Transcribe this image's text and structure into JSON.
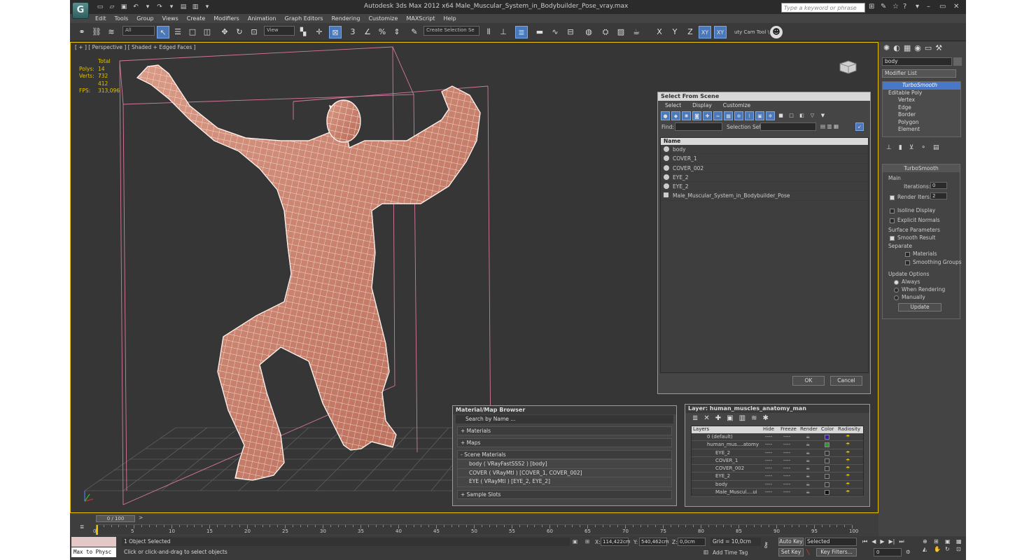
{
  "app": {
    "logo": "G",
    "title": "Autodesk 3ds Max  2012 x64     Male_Muscular_System_in_Bodybuilder_Pose_vray.max",
    "search_placeholder": "Type a keyword or phrase"
  },
  "menu": [
    "Edit",
    "Tools",
    "Group",
    "Views",
    "Create",
    "Modifiers",
    "Animation",
    "Graph Editors",
    "Rendering",
    "Customize",
    "MAXScript",
    "Help"
  ],
  "toolbar": {
    "filter": "All",
    "view": "View",
    "selection_set": "Create Selection Se",
    "axis_x": "X",
    "axis_y": "Y",
    "axis_z": "Z",
    "axis_xy": "XY",
    "axis_xy2": "XY",
    "cam_tool": "uty Cam Tool \\"
  },
  "viewport": {
    "label": "[ + ] [ Perspective ] [ Shaded + Edged Faces ]",
    "total_label": "Total",
    "polys_label": "Polys:",
    "polys_value": "14 732",
    "verts_label": "Verts:",
    "verts_value": "7 412",
    "fps_label": "FPS:",
    "fps_value": "313,096"
  },
  "command_panel": {
    "object_name": "body",
    "modifier_list": "Modifier List",
    "stack": [
      "TurboSmooth",
      "Editable Poly",
      "Vertex",
      "Edge",
      "Border",
      "Polygon",
      "Element"
    ],
    "rollout_title": "TurboSmooth",
    "main": "Main",
    "iterations_label": "Iterations:",
    "iterations_value": "0",
    "render_iters_label": "Render Iters:",
    "render_iters_value": "2",
    "isoline": "Isoline Display",
    "explicit": "Explicit Normals",
    "surface_params": "Surface Parameters",
    "smooth_result": "Smooth Result",
    "separate": "Separate",
    "materials": "Materials",
    "smoothing_groups": "Smoothing Groups",
    "update_options": "Update Options",
    "always": "Always",
    "when_rendering": "When Rendering",
    "manually": "Manually",
    "update_btn": "Update"
  },
  "select_from_scene": {
    "title": "Select From Scene",
    "menus": [
      "Select",
      "Display",
      "Customize"
    ],
    "find_label": "Find:",
    "selection_set_label": "Selection Set:",
    "name_header": "Name",
    "items": [
      "body",
      "COVER_1",
      "COVER_002",
      "EYE_2",
      "EYE_2",
      "Male_Muscular_System_in_Bodybuilder_Pose"
    ],
    "ok": "OK",
    "cancel": "Cancel"
  },
  "material_browser": {
    "title": "Material/Map Browser",
    "search_placeholder": "Search by Name ...",
    "materials": "+ Materials",
    "maps": "+ Maps",
    "scene_materials": "- Scene Materials",
    "scene_items": [
      "body  ( VRayFastSSS2 ) [body]",
      "COVER  ( VRayMtl ) [COVER_1, COVER_002]",
      "EYE  ( VRayMtl ) [EYE_2, EYE_2]"
    ],
    "sample_slots": "+ Sample Slots"
  },
  "layer_dialog": {
    "title": "Layer: human_muscles_anatomy_man",
    "columns": [
      "Layers",
      "Hide",
      "Freeze",
      "Render",
      "Color",
      "Radiosity"
    ],
    "rows": [
      {
        "name": "0 (default)",
        "color": "#3a1aa0"
      },
      {
        "name": "human_mus....atomy",
        "color": "#22a022"
      },
      {
        "name": "EYE_2",
        "color": "#333333"
      },
      {
        "name": "COVER_1",
        "color": "#333333"
      },
      {
        "name": "COVER_002",
        "color": "#333333"
      },
      {
        "name": "EYE_2",
        "color": "#333333"
      },
      {
        "name": "body",
        "color": "#333333"
      },
      {
        "name": "Male_Muscul....ui",
        "color": "#111111"
      }
    ],
    "dash": "----"
  },
  "timeline": {
    "frame": "0 / 100",
    "ticks": [
      "0",
      "5",
      "10",
      "15",
      "20",
      "25",
      "30",
      "35",
      "40",
      "45",
      "50",
      "55",
      "60",
      "65",
      "70",
      "75",
      "80",
      "85",
      "90",
      "95",
      "100"
    ]
  },
  "status": {
    "script_label": "Max to Physc",
    "selected": "1 Object Selected",
    "prompt": "Click or click-and-drag to select objects",
    "x_label": "X:",
    "x_value": "114,422cm",
    "y_label": "Y:",
    "y_value": "540,462cm",
    "z_label": "Z:",
    "z_value": "0,0cm",
    "grid": "Grid = 10,0cm",
    "add_time_tag": "Add Time Tag",
    "auto_key": "Auto Key",
    "set_key": "Set Key",
    "selected_dd": "Selected",
    "key_filters": "Key Filters...",
    "frame_value": "0"
  },
  "colors": {
    "accent": "#4a78b8",
    "viewport_border": "#e8c000",
    "stats": "#e0c000"
  }
}
